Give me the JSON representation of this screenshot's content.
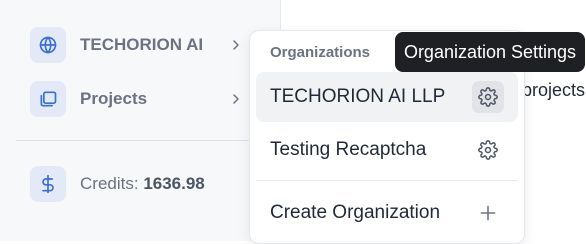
{
  "sidebar": {
    "items": [
      {
        "label": "TECHORION AI",
        "icon": "globe-icon"
      },
      {
        "label": "Projects",
        "icon": "folders-icon"
      }
    ],
    "credits": {
      "label": "Credits:",
      "value": "1636.98",
      "icon": "dollar-icon"
    }
  },
  "background": {
    "partial_text": "projects"
  },
  "org_menu": {
    "header": "Organizations",
    "orgs": [
      {
        "name": "TECHORION AI LLP",
        "settings_icon": "gear-icon"
      },
      {
        "name": "Testing Recaptcha",
        "settings_icon": "gear-icon"
      }
    ],
    "create_label": "Create Organization",
    "create_icon": "plus-icon"
  },
  "tooltip": {
    "text": "Organization Settings"
  },
  "colors": {
    "icon_blue": "#3b6fd8",
    "sidebar_bg": "#f7f8fa",
    "tooltip_bg": "#1f2023",
    "active_row_bg": "#f1f2f4"
  }
}
